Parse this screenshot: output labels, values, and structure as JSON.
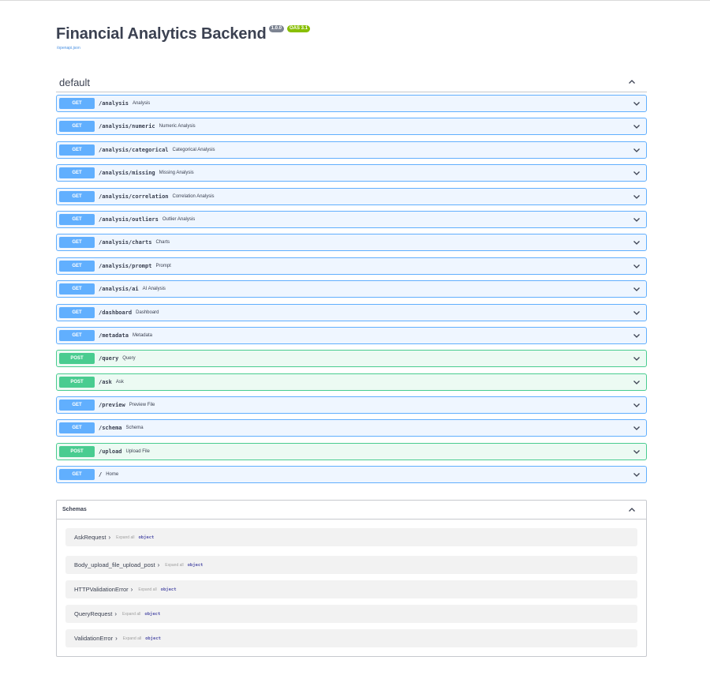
{
  "info": {
    "title": "Financial Analytics Backend",
    "version": "1.0.0",
    "oas": "OAS 3.1",
    "spec_link": "/openapi.json"
  },
  "tag": {
    "name": "default"
  },
  "operations": [
    {
      "method": "GET",
      "path": "/analysis",
      "summary": "Analysis"
    },
    {
      "method": "GET",
      "path": "/analysis/numeric",
      "summary": "Numeric Analysis"
    },
    {
      "method": "GET",
      "path": "/analysis/categorical",
      "summary": "Categorical Analysis"
    },
    {
      "method": "GET",
      "path": "/analysis/missing",
      "summary": "Missing Analysis"
    },
    {
      "method": "GET",
      "path": "/analysis/correlation",
      "summary": "Correlation Analysis"
    },
    {
      "method": "GET",
      "path": "/analysis/outliers",
      "summary": "Outlier Analysis"
    },
    {
      "method": "GET",
      "path": "/analysis/charts",
      "summary": "Charts"
    },
    {
      "method": "GET",
      "path": "/analysis/prompt",
      "summary": "Prompt"
    },
    {
      "method": "GET",
      "path": "/analysis/ai",
      "summary": "AI Analysis"
    },
    {
      "method": "GET",
      "path": "/dashboard",
      "summary": "Dashboard"
    },
    {
      "method": "GET",
      "path": "/metadata",
      "summary": "Metadata"
    },
    {
      "method": "POST",
      "path": "/query",
      "summary": "Query"
    },
    {
      "method": "POST",
      "path": "/ask",
      "summary": "Ask"
    },
    {
      "method": "GET",
      "path": "/preview",
      "summary": "Preview File"
    },
    {
      "method": "GET",
      "path": "/schema",
      "summary": "Schema"
    },
    {
      "method": "POST",
      "path": "/upload",
      "summary": "Upload File"
    },
    {
      "method": "GET",
      "path": "/",
      "summary": "Home"
    }
  ],
  "schemas": {
    "title": "Schemas",
    "models": [
      {
        "name": "AskRequest",
        "arrow": "›",
        "expand": "Expand all",
        "type": "object"
      },
      {
        "name": "Body_upload_file_upload_post",
        "arrow": "›",
        "expand": "Expand all",
        "type": "object"
      },
      {
        "name": "HTTPValidationError",
        "arrow": "›",
        "expand": "Expand all",
        "type": "object"
      },
      {
        "name": "QueryRequest",
        "arrow": "›",
        "expand": "Expand all",
        "type": "object"
      },
      {
        "name": "ValidationError",
        "arrow": "›",
        "expand": "Expand all",
        "type": "object"
      }
    ]
  },
  "colors": {
    "get": "#61affe",
    "get_bg": "#eff6ff",
    "post": "#49cc90",
    "post_bg": "#ecfaf3",
    "version_badge": "#7d8492",
    "oas_badge": "#89bf04"
  },
  "icons": {
    "collapse": "chevron-up-icon",
    "expand": "chevron-down-icon"
  }
}
